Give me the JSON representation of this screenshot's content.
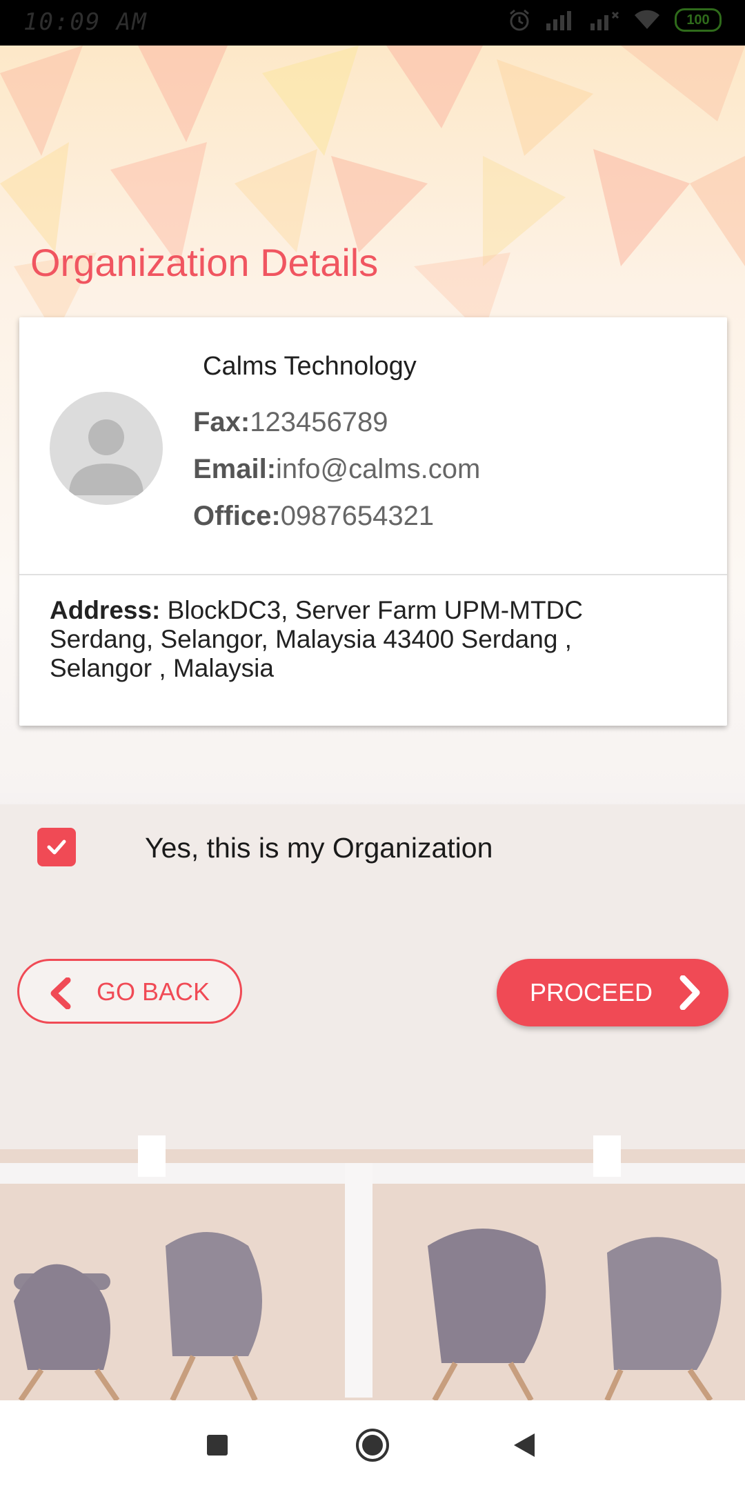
{
  "status_bar": {
    "time": "10:09 AM",
    "battery": "100",
    "icons": [
      "alarm-icon",
      "signal-icon",
      "signal-icon",
      "wifi-icon",
      "battery-icon"
    ]
  },
  "page": {
    "title": "Organization Details"
  },
  "organization": {
    "name": "Calms Technology",
    "fax_label": "Fax:",
    "fax_value": "123456789",
    "email_label": "Email:",
    "email_value": "info@calms.com",
    "office_label": "Office:",
    "office_value": "0987654321",
    "address_label": "Address:",
    "address_value": " BlockDC3, Server Farm UPM-MTDC Serdang, Selangor, Malaysia 43400 Serdang , Selangor , Malaysia"
  },
  "confirm": {
    "checked": true,
    "label": "Yes, this is my Organization"
  },
  "buttons": {
    "back_label": "GO BACK",
    "proceed_label": "PROCEED"
  },
  "colors": {
    "accent": "#f04a55",
    "title": "#f05560"
  },
  "nav_bar": {
    "icons": [
      "recent-apps-icon",
      "home-icon",
      "back-icon"
    ]
  }
}
